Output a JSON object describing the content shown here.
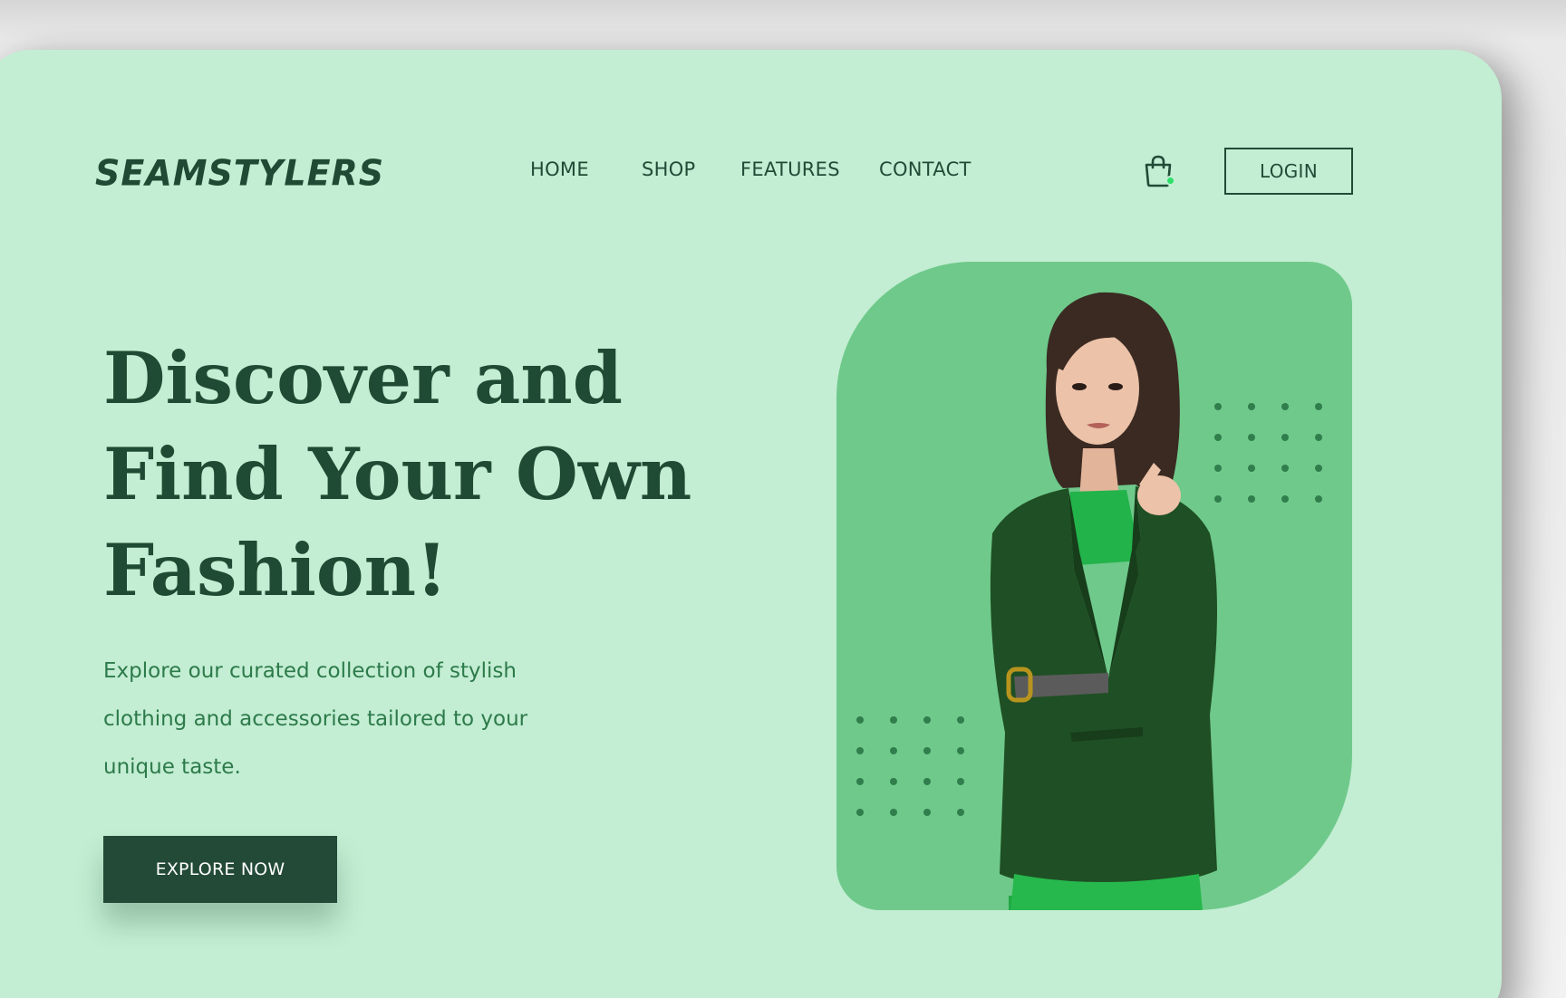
{
  "brand": {
    "name": "SEAMSTYLERS"
  },
  "nav": {
    "items": [
      {
        "label": "HOME"
      },
      {
        "label": "SHOP"
      },
      {
        "label": "FEATURES"
      },
      {
        "label": "CONTACT"
      }
    ],
    "cart_icon": "shopping-bag-icon",
    "login_label": "LOGIN"
  },
  "hero": {
    "title_lines": [
      "Discover and",
      "Find Your Own",
      "Fashion!"
    ],
    "description_lines": [
      "Explore our curated collection of stylish",
      "clothing and accessories tailored to your",
      "unique taste."
    ],
    "cta_label": "EXPLORE NOW",
    "image": "woman-in-green-blazer-photo"
  },
  "colors": {
    "background": "#c3eed3",
    "primary_dark": "#234a37",
    "panel_green": "#6fc98b",
    "text_green": "#2d7a4a",
    "cart_badge": "#2ee06a"
  }
}
